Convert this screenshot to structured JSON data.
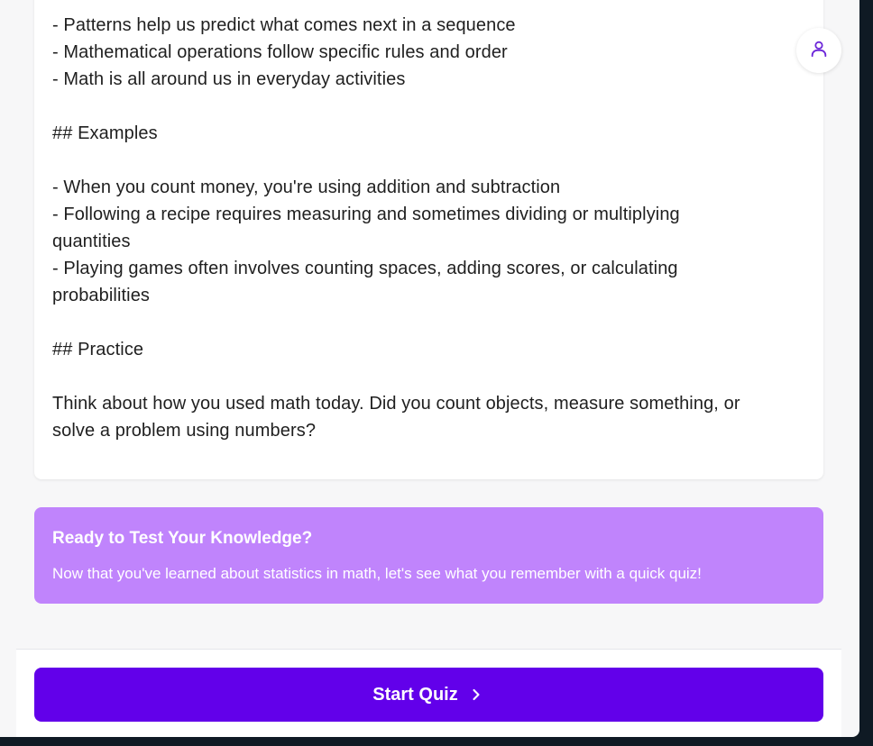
{
  "lesson": {
    "lines": [
      "- Patterns help us predict what comes next in a sequence",
      "- Mathematical operations follow specific rules and order",
      "- Math is all around us in everyday activities",
      "## Examples",
      "- When you count money, you're using addition and subtraction",
      "- Following a recipe requires measuring and sometimes dividing or multiplying",
      "quantities",
      "- Playing games often involves counting spaces, adding scores, or calculating",
      "probabilities",
      "## Practice",
      "Think about how you used math today. Did you count objects, measure something, or",
      "solve a problem using numbers?"
    ]
  },
  "cta": {
    "title": "Ready to Test Your Knowledge?",
    "text": "Now that you've learned about statistics in math, let's see what you remember with a quick quiz!"
  },
  "footer": {
    "start_label": "Start Quiz"
  },
  "icons": {
    "profile": "user-icon",
    "start": "chevron-right-icon"
  },
  "colors": {
    "accent": "#6200ea",
    "cta_bg": "#c084fc",
    "icon": "#6d28d9"
  }
}
